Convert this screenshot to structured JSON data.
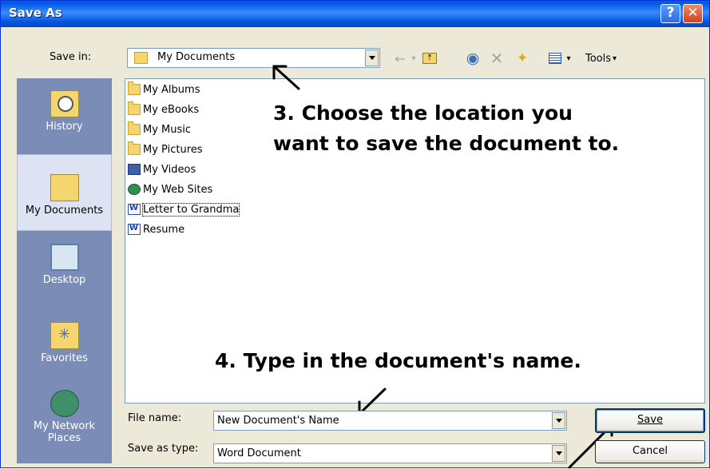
{
  "window": {
    "title": "Save As",
    "help_glyph": "?",
    "close_glyph": "✕"
  },
  "toolbar": {
    "save_in_label": "Save in:",
    "save_in_value": "My Documents",
    "tools_label": "Tools"
  },
  "places": [
    {
      "label": "History",
      "icon": "history-icon"
    },
    {
      "label": "My Documents",
      "icon": "my-documents-icon"
    },
    {
      "label": "Desktop",
      "icon": "desktop-icon"
    },
    {
      "label": "Favorites",
      "icon": "favorites-icon"
    },
    {
      "label": "My Network Places",
      "label_line1": "My Network",
      "label_line2": "Places",
      "icon": "network-icon"
    }
  ],
  "files": [
    {
      "name": "My Albums",
      "type": "folder"
    },
    {
      "name": "My eBooks",
      "type": "folder"
    },
    {
      "name": "My Music",
      "type": "music-folder"
    },
    {
      "name": "My Pictures",
      "type": "folder"
    },
    {
      "name": "My Videos",
      "type": "video-folder"
    },
    {
      "name": "My Web Sites",
      "type": "web-folder"
    },
    {
      "name": "Letter to Grandma",
      "type": "word-document"
    },
    {
      "name": "Resume",
      "type": "word-document"
    }
  ],
  "instructions": {
    "step3_line1": "3. Choose the location you",
    "step3_line2": "want to save the document to.",
    "step4": "4. Type in the document's name."
  },
  "form": {
    "file_name_label": "File name:",
    "file_name_value": "New Document's Name",
    "save_as_type_label": "Save as type:",
    "save_as_type_value": "Word Document"
  },
  "buttons": {
    "save": "Save",
    "cancel": "Cancel"
  }
}
